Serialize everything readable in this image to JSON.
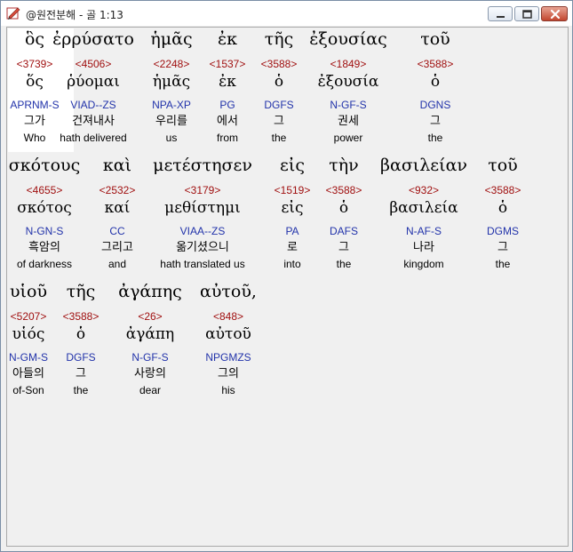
{
  "window": {
    "title": "@원전분해 - 골 1:13",
    "controls": [
      "minimize-icon",
      "maximize-icon",
      "close-icon"
    ]
  },
  "words": [
    {
      "greek": "ὃς",
      "strong": "<3739>",
      "lemma": "ὅς",
      "parse": "APRNM-S",
      "korean": "그가",
      "english": "Who"
    },
    {
      "greek": "ἐρρύσατο",
      "strong": "<4506>",
      "lemma": "ῥύομαι",
      "parse": "VIAD--ZS",
      "korean": "건져내사",
      "english": "hath delivered"
    },
    {
      "greek": "ἡμᾶς",
      "strong": "<2248>",
      "lemma": "ἡμᾶς",
      "parse": "NPA-XP",
      "korean": "우리를",
      "english": "us"
    },
    {
      "greek": "ἐκ",
      "strong": "<1537>",
      "lemma": "ἐκ",
      "parse": "PG",
      "korean": "에서",
      "english": "from"
    },
    {
      "greek": "τῆς",
      "strong": "<3588>",
      "lemma": "ὁ",
      "parse": "DGFS",
      "korean": "그",
      "english": "the"
    },
    {
      "greek": "ἐξουσίας",
      "strong": "<1849>",
      "lemma": "ἐξουσία",
      "parse": "N-GF-S",
      "korean": "권세",
      "english": "power"
    },
    {
      "greek": "τοῦ",
      "strong": "<3588>",
      "lemma": "ὁ",
      "parse": "DGNS",
      "korean": "그",
      "english": "the"
    },
    {
      "greek": "σκότους",
      "strong": "<4655>",
      "lemma": "σκότος",
      "parse": "N-GN-S",
      "korean": "흑암의",
      "english": "of darkness"
    },
    {
      "greek": "καὶ",
      "strong": "<2532>",
      "lemma": "καί",
      "parse": "CC",
      "korean": "그리고",
      "english": "and"
    },
    {
      "greek": "μετέστησεν",
      "strong": "<3179>",
      "lemma": "μεθίστημι",
      "parse": "VIAA--ZS",
      "korean": "옮기셨으니",
      "english": "hath translated us"
    },
    {
      "greek": "εἰς",
      "strong": "<1519>",
      "lemma": "εἰς",
      "parse": "PA",
      "korean": "로",
      "english": "into"
    },
    {
      "greek": "τὴν",
      "strong": "<3588>",
      "lemma": "ὁ",
      "parse": "DAFS",
      "korean": "그",
      "english": "the"
    },
    {
      "greek": "βασιλείαν",
      "strong": "<932>",
      "lemma": "βασιλεία",
      "parse": "N-AF-S",
      "korean": "나라",
      "english": "kingdom"
    },
    {
      "greek": "τοῦ",
      "strong": "<3588>",
      "lemma": "ὁ",
      "parse": "DGMS",
      "korean": "그",
      "english": "the"
    },
    {
      "greek": "υἱοῦ",
      "strong": "<5207>",
      "lemma": "υἱός",
      "parse": "N-GM-S",
      "korean": "아들의",
      "english": "of-Son"
    },
    {
      "greek": "τῆς",
      "strong": "<3588>",
      "lemma": "ὁ",
      "parse": "DGFS",
      "korean": "그",
      "english": "the"
    },
    {
      "greek": "ἀγάπης",
      "strong": "<26>",
      "lemma": "ἀγάπη",
      "parse": "N-GF-S",
      "korean": "사랑의",
      "english": "dear"
    },
    {
      "greek": "αὐτοῦ,",
      "strong": "<848>",
      "lemma": "αὐτοῦ",
      "parse": "NPGMZS",
      "korean": "그의",
      "english": "his"
    }
  ]
}
